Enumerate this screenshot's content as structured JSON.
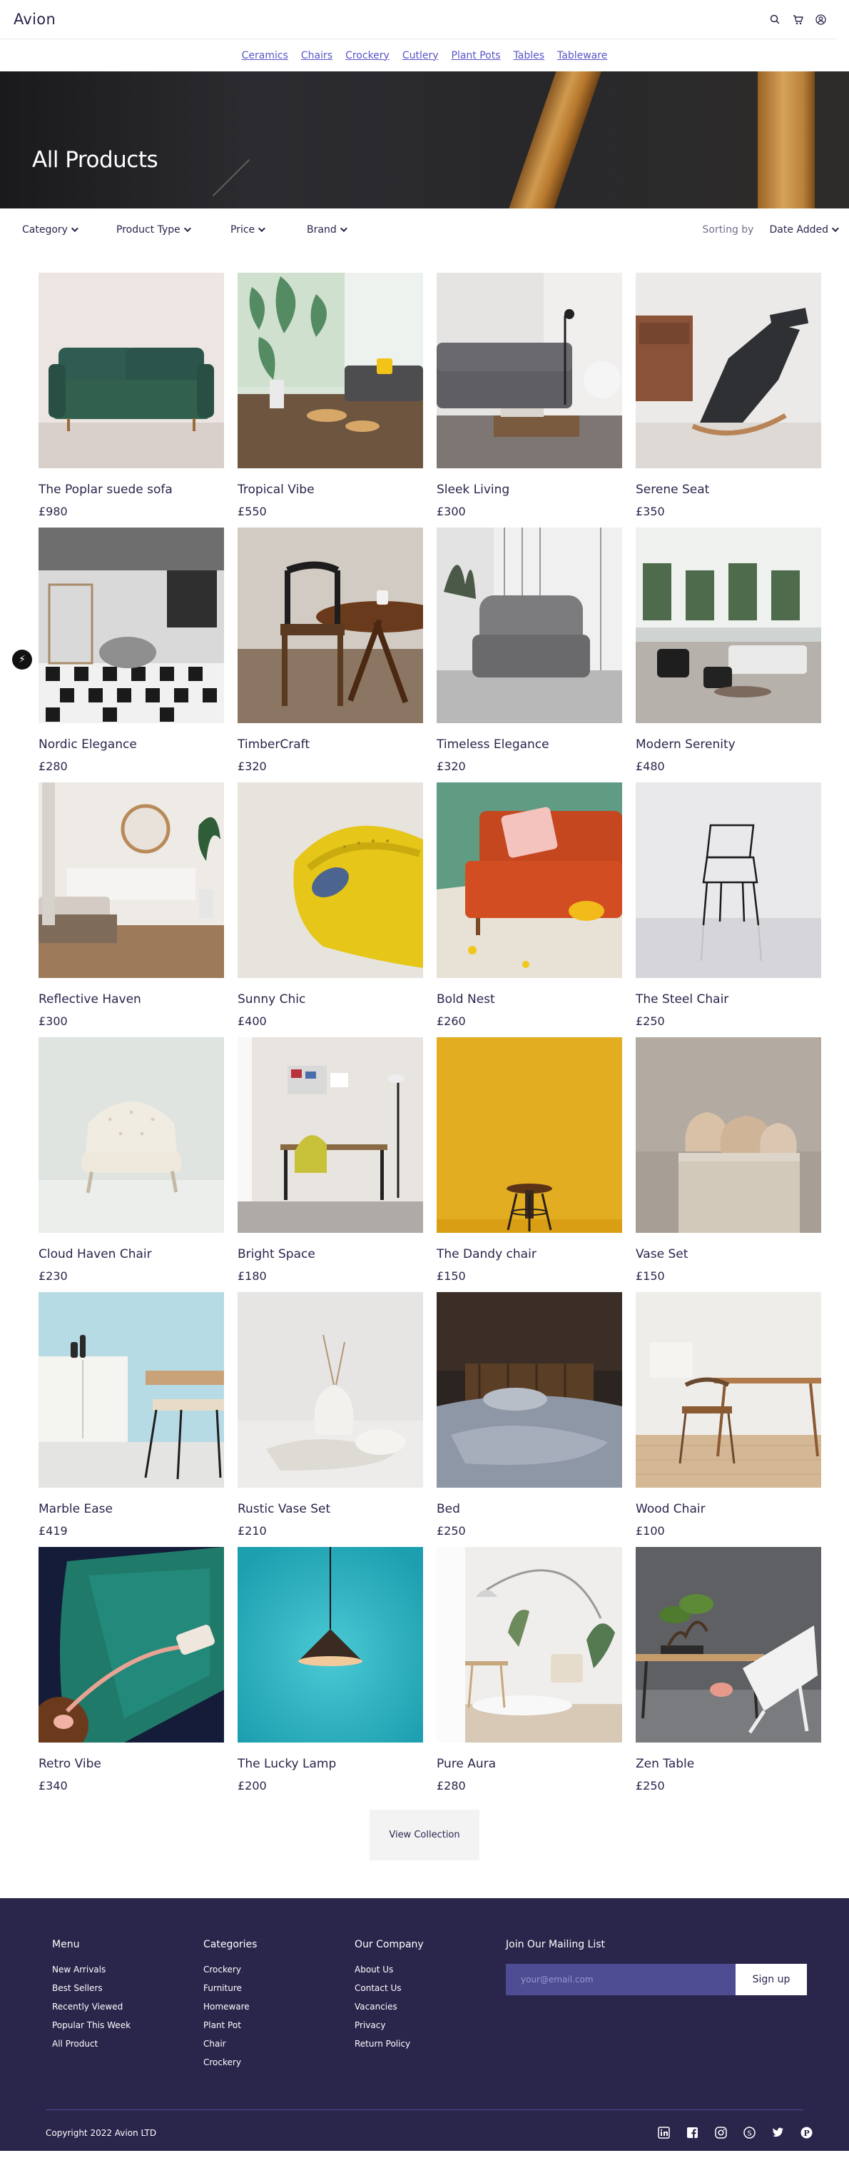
{
  "header": {
    "logo": "Avion",
    "icons": [
      "search-icon",
      "cart-icon",
      "user-icon"
    ]
  },
  "nav": {
    "categories": [
      "Ceramics",
      "Chairs",
      "Crockery",
      "Cutlery",
      "Plant Pots",
      "Tables",
      "Tableware"
    ]
  },
  "hero": {
    "title": "All Products"
  },
  "filters": {
    "items": [
      "Category",
      "Product Type",
      "Price",
      "Brand"
    ],
    "sort_label": "Sorting by",
    "sort_value": "Date Added"
  },
  "products": [
    {
      "name": "The Poplar suede sofa",
      "price": "£980",
      "image": "green-velvet-sofa"
    },
    {
      "name": "Tropical Vibe",
      "price": "£550",
      "image": "tropical-living-room"
    },
    {
      "name": "Sleek Living",
      "price": "£300",
      "image": "grey-sofa-living-room"
    },
    {
      "name": "Serene Seat",
      "price": "£350",
      "image": "lounge-chair"
    },
    {
      "name": "Nordic Elegance",
      "price": "£280",
      "image": "nordic-room-patterned-rug"
    },
    {
      "name": "TimberCraft",
      "price": "£320",
      "image": "wooden-chair-and-table"
    },
    {
      "name": "Timeless Elegance",
      "price": "£320",
      "image": "grey-armchair"
    },
    {
      "name": "Modern Serenity",
      "price": "£480",
      "image": "modern-living-space"
    },
    {
      "name": "Reflective Haven",
      "price": "£300",
      "image": "bedroom-with-round-mirror"
    },
    {
      "name": "Sunny Chic",
      "price": "£400",
      "image": "yellow-chair"
    },
    {
      "name": "Bold Nest",
      "price": "£260",
      "image": "orange-sofa"
    },
    {
      "name": "The Steel Chair",
      "price": "£250",
      "image": "black-wire-chair"
    },
    {
      "name": "Cloud Haven Chair",
      "price": "£230",
      "image": "white-tufted-chair"
    },
    {
      "name": "Bright Space",
      "price": "£180",
      "image": "home-office-desk"
    },
    {
      "name": "The Dandy chair",
      "price": "£150",
      "image": "bar-stool-yellow-wall"
    },
    {
      "name": "Vase Set",
      "price": "£150",
      "image": "ceramic-vases"
    },
    {
      "name": "Marble Ease",
      "price": "£419",
      "image": "white-sideboard-chair"
    },
    {
      "name": "Rustic Vase Set",
      "price": "£210",
      "image": "white-vase-set"
    },
    {
      "name": "Bed",
      "price": "£250",
      "image": "dark-bedroom"
    },
    {
      "name": "Wood Chair",
      "price": "£100",
      "image": "wood-chair-dining"
    },
    {
      "name": "Retro Vibe",
      "price": "£340",
      "image": "retro-green-chair-phone"
    },
    {
      "name": "The Lucky Lamp",
      "price": "£200",
      "image": "pendant-lamp"
    },
    {
      "name": "Pure Aura",
      "price": "£280",
      "image": "white-room-arc-lamp"
    },
    {
      "name": "Zen Table",
      "price": "£250",
      "image": "bonsai-table-white-chair"
    }
  ],
  "view_collection": "View Collection",
  "footer": {
    "columns": [
      {
        "title": "Menu",
        "links": [
          "New Arrivals",
          "Best Sellers",
          "Recently Viewed",
          "Popular This Week",
          "All Product"
        ]
      },
      {
        "title": "Categories",
        "links": [
          "Crockery",
          "Furniture",
          "Homeware",
          "Plant Pot",
          "Chair",
          "Crockery"
        ]
      },
      {
        "title": "Our Company",
        "links": [
          "About Us",
          "Contact Us",
          "Vacancies",
          "Privacy",
          "Return Policy"
        ]
      }
    ],
    "mailing": {
      "title": "Join Our Mailing List",
      "placeholder": "your@email.com",
      "button": "Sign up"
    },
    "copyright": "Copyright 2022 Avion LTD",
    "socials": [
      "linkedin-icon",
      "facebook-icon",
      "instagram-icon",
      "skype-icon",
      "twitter-icon",
      "pinterest-icon"
    ]
  },
  "colors": {
    "brand": "#2a254b",
    "nav_link": "#5a54c8",
    "footer_bg": "#2a254b",
    "input_bg": "#4e4d93"
  }
}
